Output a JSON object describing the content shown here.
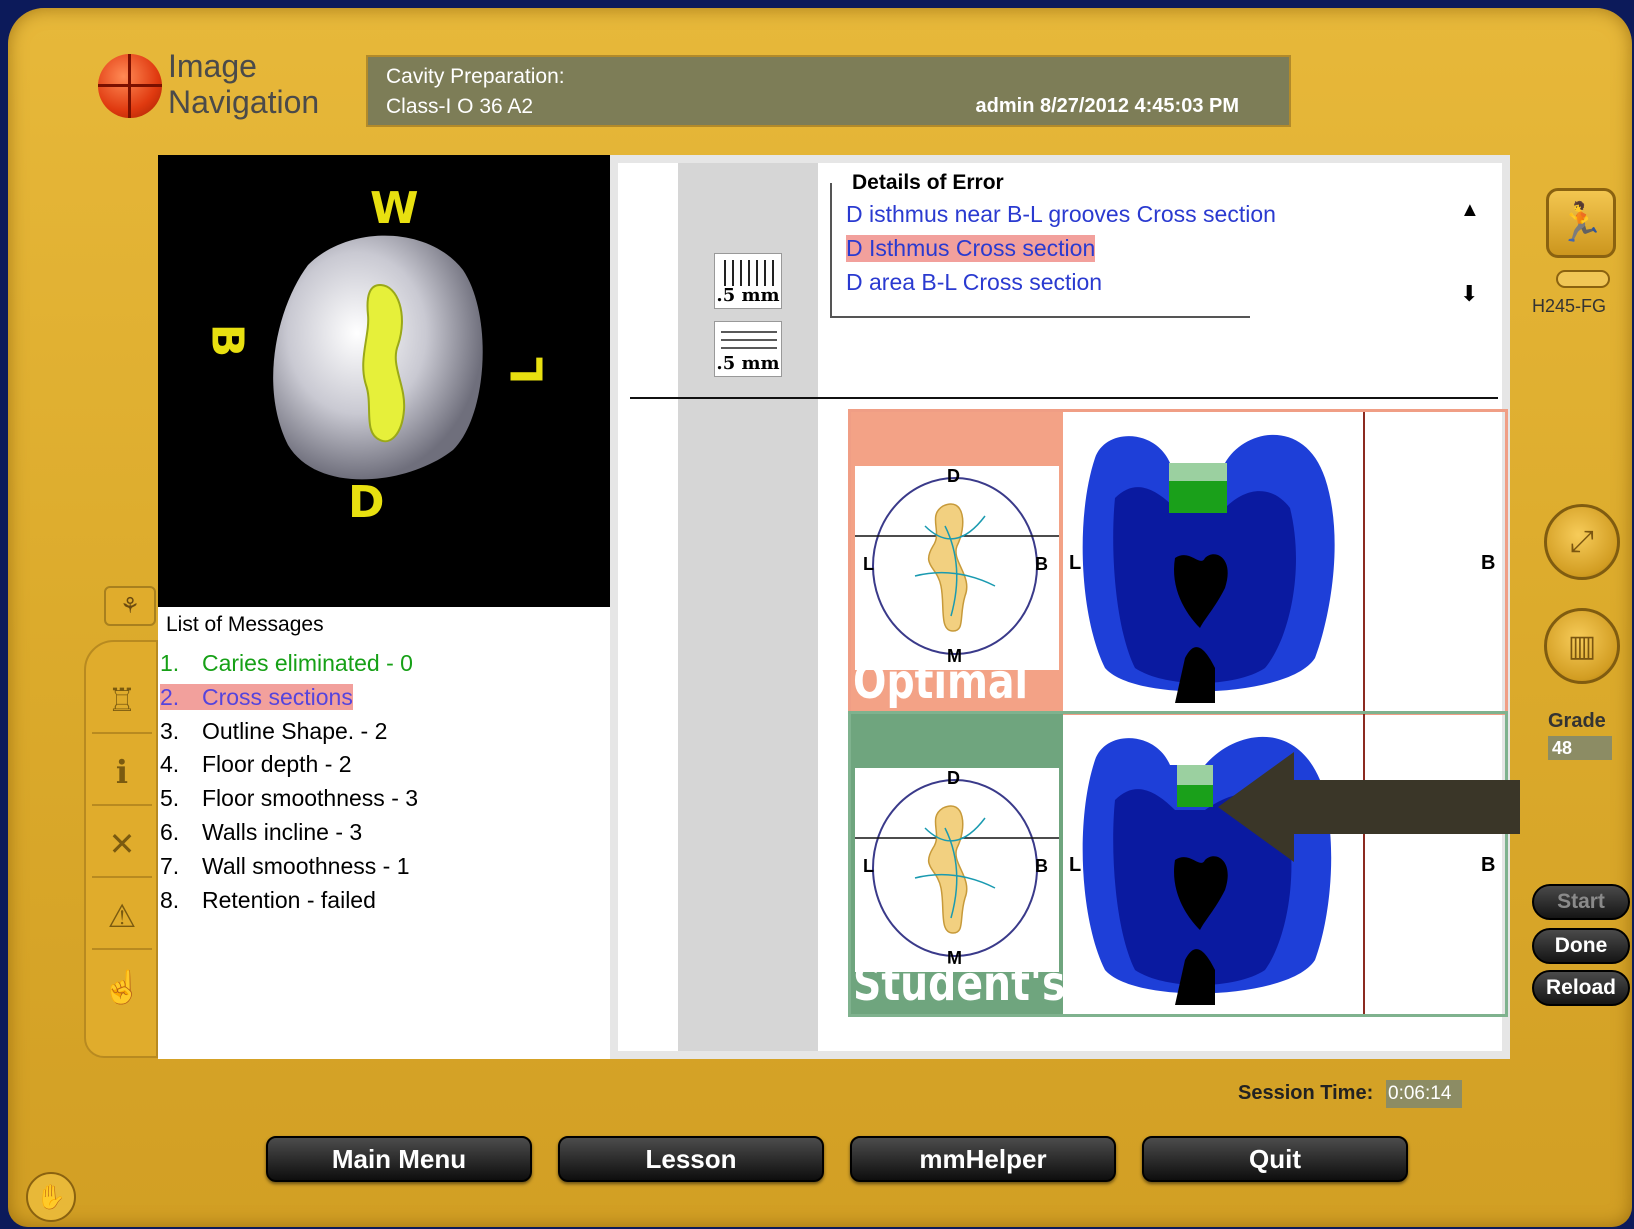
{
  "app": {
    "logo_line1": "Image",
    "logo_line2": "Navigation"
  },
  "header": {
    "line1": "Cavity Preparation:",
    "line2": "Class-I O 36 A2",
    "user_time": "admin 8/27/2012 4:45:03 PM"
  },
  "orientation": {
    "top": "W",
    "left": "B",
    "right": "L",
    "bottom": "D"
  },
  "messages": {
    "title": "List of Messages",
    "items": [
      {
        "num": "1.",
        "text": "Caries eliminated - 0",
        "style": "green"
      },
      {
        "num": "2.",
        "text": "Cross sections",
        "style": "sel"
      },
      {
        "num": "3.",
        "text": "Outline Shape. - 2",
        "style": ""
      },
      {
        "num": "4.",
        "text": "Floor depth  - 2",
        "style": ""
      },
      {
        "num": "5.",
        "text": "Floor smoothness - 3",
        "style": ""
      },
      {
        "num": "6.",
        "text": "Walls incline - 3",
        "style": ""
      },
      {
        "num": "7.",
        "text": "Wall smoothness  - 1",
        "style": ""
      },
      {
        "num": "8.",
        "text": "Retention - failed",
        "style": ""
      }
    ]
  },
  "scale": {
    "vertical": ".5 mm",
    "horizontal": ".5 mm"
  },
  "error_details": {
    "title": "Details of Error",
    "items": [
      "D isthmus near B-L grooves Cross section",
      "D Isthmus Cross section",
      "D area B-L Cross section"
    ]
  },
  "comparison": {
    "optimal_label": "Optimal",
    "student_label": "Student's",
    "sketch_labels": {
      "top": "D",
      "bottom": "M",
      "left": "L",
      "right": "B"
    },
    "section_labels": {
      "left": "L",
      "right": "B"
    }
  },
  "right_tools": {
    "tool_name": "H245-FG",
    "grade_label": "Grade",
    "grade_value": "48"
  },
  "side_buttons": {
    "start": "Start",
    "done": "Done",
    "reload": "Reload"
  },
  "session": {
    "label": "Session Time:",
    "value": "0:06:14"
  },
  "bottom_nav": {
    "main_menu": "Main Menu",
    "lesson": "Lesson",
    "helper": "mmHelper",
    "quit": "Quit"
  },
  "colors": {
    "frame": "#dcab2c",
    "header_bg": "#7d7d57",
    "enamel": "#1e3fd8",
    "dentin": "#0a1aa0",
    "optimal_accent": "#f3a286",
    "student_accent": "#6fa57e"
  }
}
